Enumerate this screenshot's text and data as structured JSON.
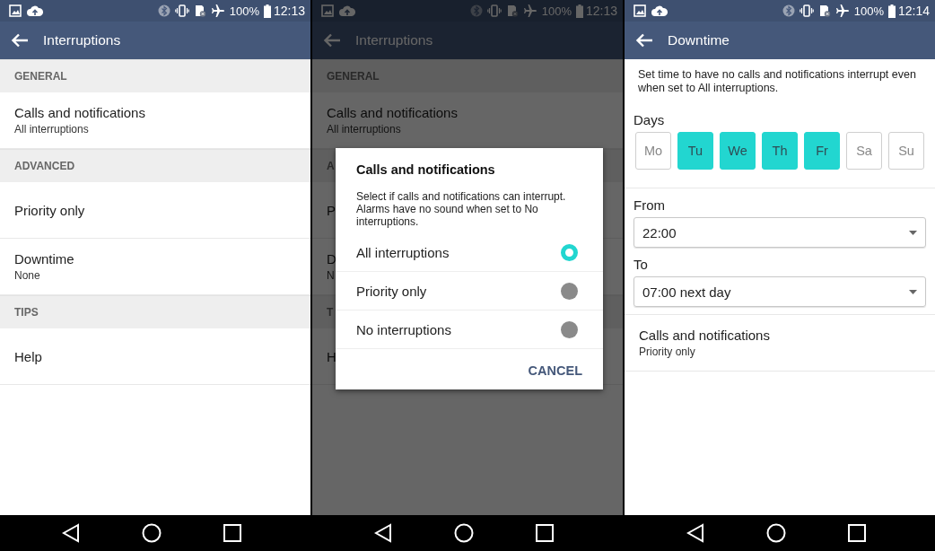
{
  "screens": [
    {
      "status_bar": {
        "battery": "100%",
        "time": "12:13"
      },
      "dimmed": false,
      "app_bar": {
        "title": "Interruptions"
      },
      "content": [
        {
          "kind": "header",
          "label": "GENERAL"
        },
        {
          "kind": "item",
          "title": "Calls and notifications",
          "subtitle": "All interruptions"
        },
        {
          "kind": "header",
          "label": "ADVANCED"
        },
        {
          "kind": "item",
          "title": "Priority only"
        },
        {
          "kind": "item",
          "title": "Downtime",
          "subtitle": "None"
        },
        {
          "kind": "header",
          "label": "TIPS"
        },
        {
          "kind": "item",
          "title": "Help"
        }
      ]
    },
    {
      "status_bar": {
        "battery": "100%",
        "time": "12:13"
      },
      "dimmed": true,
      "app_bar": {
        "title": "Interruptions"
      },
      "content": [
        {
          "kind": "header",
          "label": "GENERAL"
        },
        {
          "kind": "item",
          "title": "Calls and notifications",
          "subtitle": "All interruptions"
        },
        {
          "kind": "header",
          "label": "A"
        },
        {
          "kind": "item",
          "title": "P"
        },
        {
          "kind": "item",
          "title": "D",
          "subtitle": "N"
        },
        {
          "kind": "header",
          "label": "T"
        },
        {
          "kind": "item",
          "title": "H"
        }
      ],
      "dialog": {
        "title": "Calls and notifications",
        "message": "Select if calls and notifications can interrupt. Alarms have no sound when set to No interruptions.",
        "options": [
          {
            "label": "All interruptions",
            "selected": true
          },
          {
            "label": "Priority only",
            "selected": false
          },
          {
            "label": "No interruptions",
            "selected": false
          }
        ],
        "button": "CANCEL"
      }
    },
    {
      "status_bar": {
        "battery": "100%",
        "time": "12:14"
      },
      "dimmed": false,
      "app_bar": {
        "title": "Downtime"
      },
      "content": [
        {
          "kind": "text",
          "text": "Set time to have no calls and notifications interrupt even when set to All interruptions."
        },
        {
          "kind": "days",
          "label": "Days",
          "days": [
            {
              "label": "Mo",
              "selected": false
            },
            {
              "label": "Tu",
              "selected": true
            },
            {
              "label": "We",
              "selected": true
            },
            {
              "label": "Th",
              "selected": true
            },
            {
              "label": "Fr",
              "selected": true
            },
            {
              "label": "Sa",
              "selected": false
            },
            {
              "label": "Su",
              "selected": false
            }
          ]
        },
        {
          "kind": "dropdown",
          "label": "From",
          "value": "22:00"
        },
        {
          "kind": "dropdown",
          "label": "To",
          "value": "07:00 next day"
        },
        {
          "kind": "item",
          "title": "Calls and notifications",
          "subtitle": "Priority only"
        }
      ]
    }
  ]
}
